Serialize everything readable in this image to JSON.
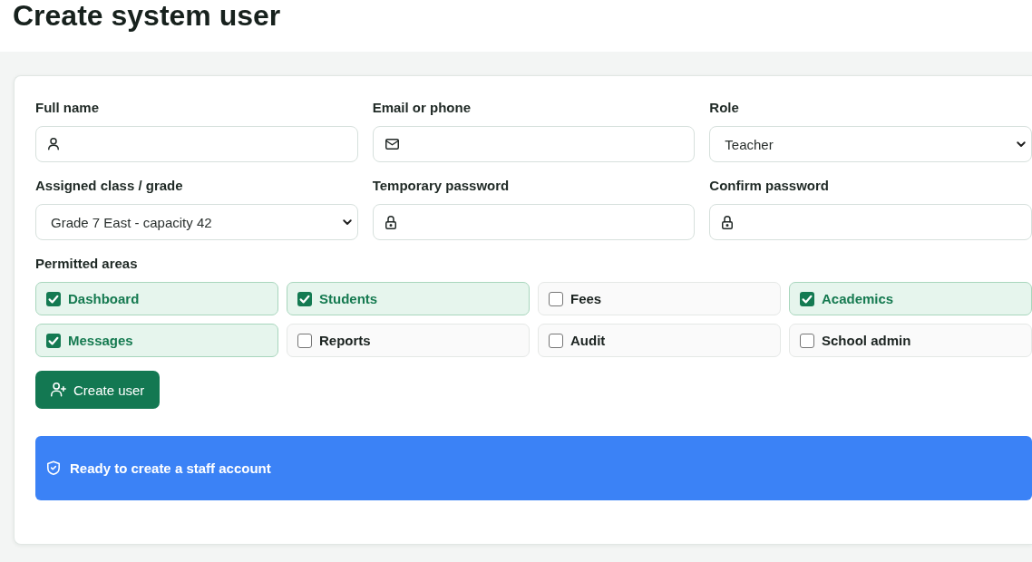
{
  "page": {
    "title": "Create system user"
  },
  "form": {
    "fields": [
      {
        "label": "Full name",
        "kind": "name"
      },
      {
        "label": "Email or phone",
        "kind": "contact"
      },
      {
        "label": "Role",
        "kind": "select",
        "value": "Teacher"
      },
      {
        "label": "Assigned class / grade",
        "kind": "select",
        "value": "Grade 7 East - capacity 42"
      },
      {
        "label": "Temporary password",
        "kind": "password"
      },
      {
        "label": "Confirm password",
        "kind": "password"
      }
    ],
    "permissions": {
      "label": "Permitted areas",
      "areas": [
        {
          "label": "Dashboard",
          "checked": true
        },
        {
          "label": "Students",
          "checked": true
        },
        {
          "label": "Fees",
          "checked": false
        },
        {
          "label": "Academics",
          "checked": true
        },
        {
          "label": "Messages",
          "checked": true
        },
        {
          "label": "Reports",
          "checked": false
        },
        {
          "label": "Audit",
          "checked": false
        },
        {
          "label": "School admin",
          "checked": false
        }
      ]
    },
    "submit_button": {
      "label": "Create user"
    }
  },
  "banner": {
    "text": "Ready to create a staff account"
  }
}
